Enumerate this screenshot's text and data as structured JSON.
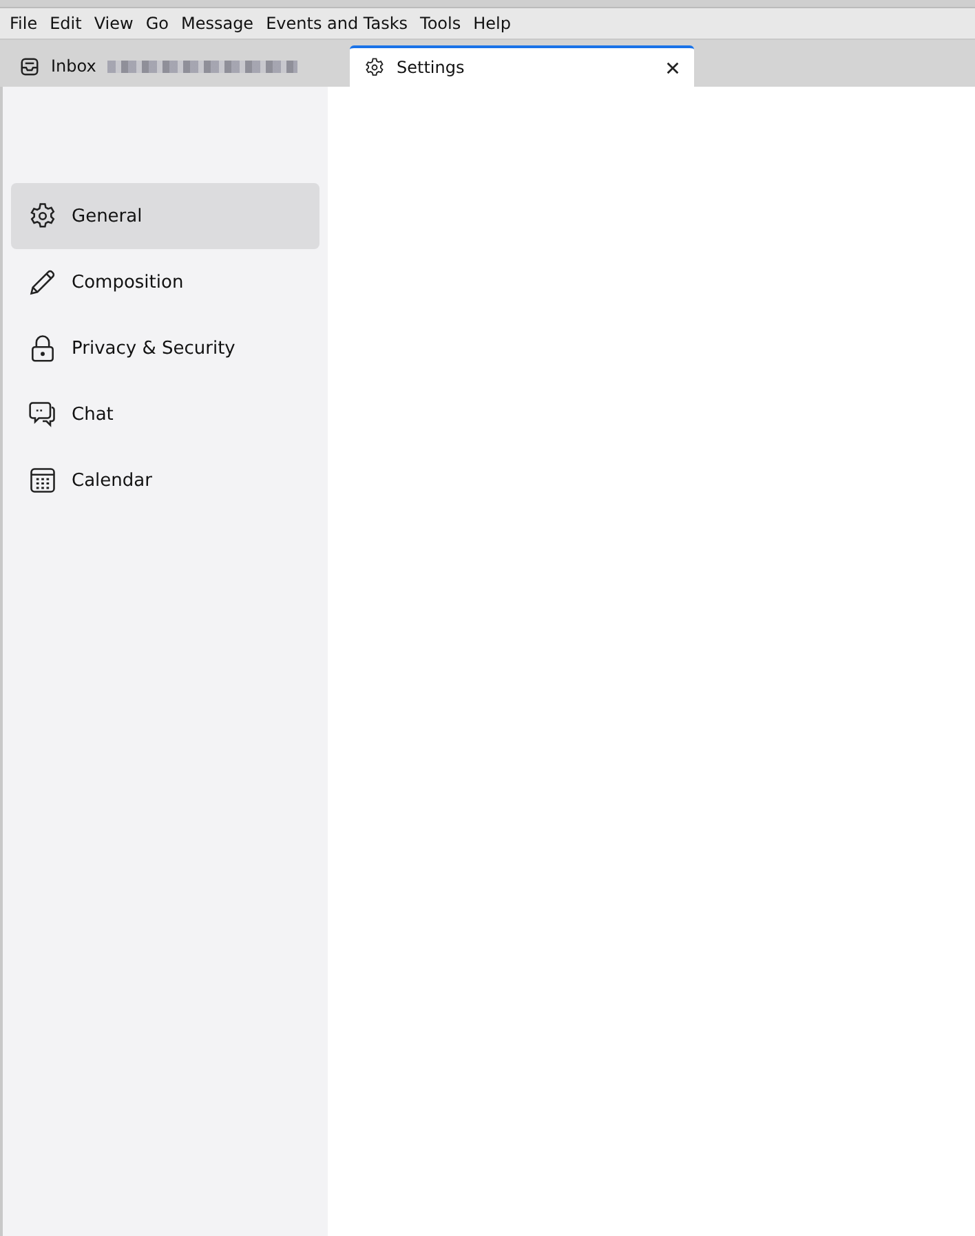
{
  "menu_bar": [
    "File",
    "Edit",
    "View",
    "Go",
    "Message",
    "Events and Tasks",
    "Tools",
    "Help"
  ],
  "tabs": [
    {
      "kind": "inbox",
      "label": "Inbox",
      "selected": false,
      "closable": false
    },
    {
      "kind": "settings",
      "label": "Settings",
      "selected": true,
      "closable": true
    }
  ],
  "sidebar": {
    "items": [
      {
        "kind": "general",
        "label": "General",
        "selected": true
      },
      {
        "kind": "composition",
        "label": "Composition",
        "selected": false
      },
      {
        "kind": "privacy",
        "label": "Privacy & Security",
        "selected": false
      },
      {
        "kind": "chat",
        "label": "Chat",
        "selected": false
      },
      {
        "kind": "calendar",
        "label": "Calendar",
        "selected": false
      }
    ]
  }
}
